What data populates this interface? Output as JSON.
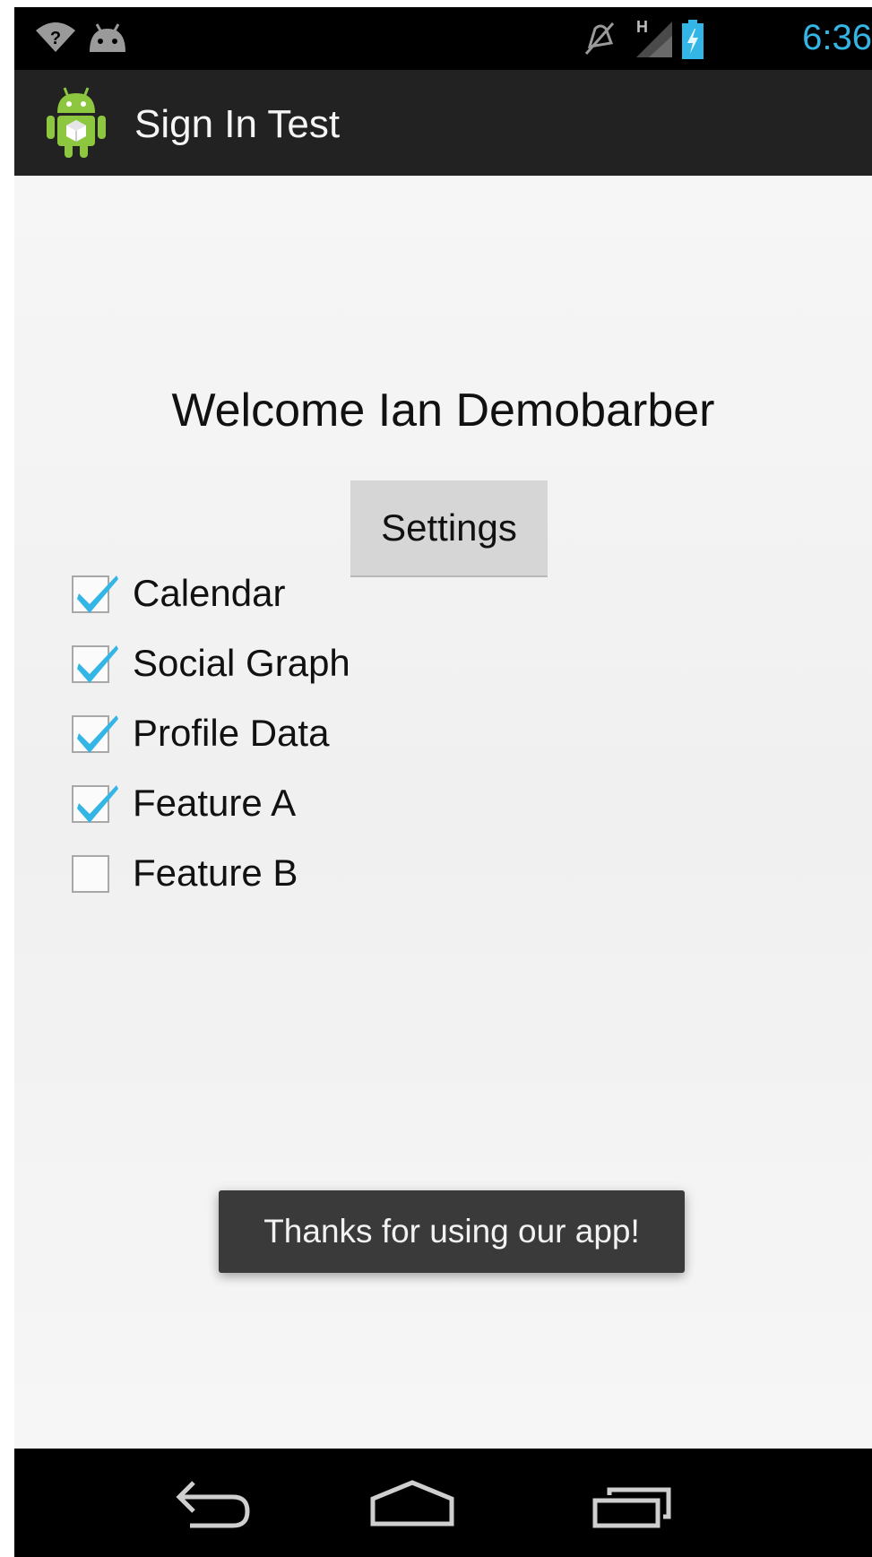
{
  "status_bar": {
    "time": "6:36",
    "network_label": "H",
    "icons": [
      "wifi-icon",
      "android-notification-icon",
      "mute-icon",
      "signal-icon",
      "battery-charging-icon"
    ]
  },
  "action_bar": {
    "title": "Sign In Test",
    "icon": "android-app-icon"
  },
  "main": {
    "welcome_text": "Welcome Ian Demobarber",
    "settings_label": "Settings",
    "checkboxes": [
      {
        "label": "Calendar",
        "checked": true
      },
      {
        "label": "Social Graph",
        "checked": true
      },
      {
        "label": "Profile Data",
        "checked": true
      },
      {
        "label": "Feature A",
        "checked": true
      },
      {
        "label": "Feature B",
        "checked": false
      }
    ]
  },
  "toast": {
    "message": "Thanks for using our app!"
  },
  "nav_bar": {
    "buttons": [
      "back-icon",
      "home-icon",
      "recents-icon"
    ]
  },
  "colors": {
    "accent": "#33b5e5",
    "action_bar": "#222222",
    "toast_bg": "#3a3a3a"
  }
}
